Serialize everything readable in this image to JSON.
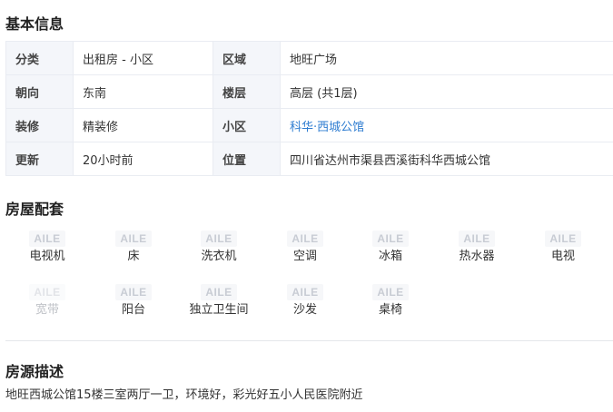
{
  "basic": {
    "title": "基本信息",
    "rows": [
      {
        "k1": "分类",
        "v1": "出租房 - 小区",
        "k2": "区域",
        "v2": "地旺广场"
      },
      {
        "k1": "朝向",
        "v1": "东南",
        "k2": "楼层",
        "v2": "高层 (共1层)"
      },
      {
        "k1": "装修",
        "v1": "精装修",
        "k2": "小区",
        "v2": "科华·西城公馆"
      },
      {
        "k1": "更新",
        "v1": "20小时前",
        "k2": "位置",
        "v2": "四川省达州市渠县西溪街科华西城公馆"
      }
    ],
    "link_color": "#2f7dd1"
  },
  "facilities": {
    "title": "房屋配套",
    "icon_placeholder_text": "AILE",
    "items": [
      {
        "label": "电视机",
        "available": true
      },
      {
        "label": "床",
        "available": true
      },
      {
        "label": "洗衣机",
        "available": true
      },
      {
        "label": "空调",
        "available": true
      },
      {
        "label": "冰箱",
        "available": true
      },
      {
        "label": "热水器",
        "available": true
      },
      {
        "label": "电视",
        "available": true
      },
      {
        "label": "宽带",
        "available": false
      },
      {
        "label": "阳台",
        "available": true
      },
      {
        "label": "独立卫生间",
        "available": true
      },
      {
        "label": "沙发",
        "available": true
      },
      {
        "label": "桌椅",
        "available": true
      }
    ]
  },
  "description": {
    "title": "房源描述",
    "text": "地旺西城公馆15楼三室两厅一卫，环境好，彩光好五小人民医院附近"
  }
}
